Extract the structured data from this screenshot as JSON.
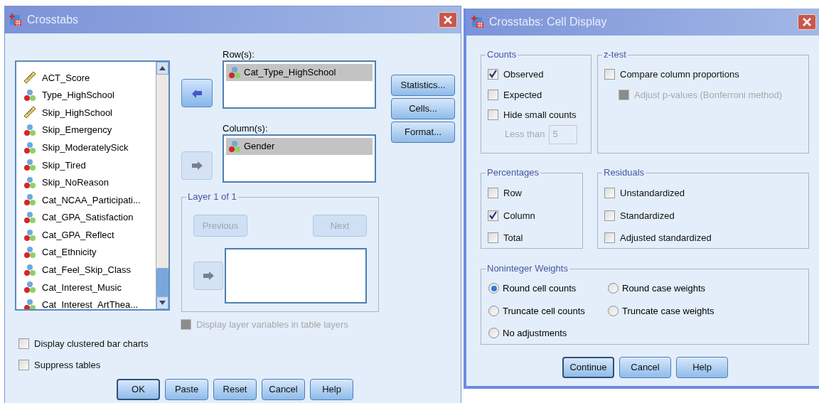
{
  "main_dialog": {
    "title": "Crosstabs",
    "variables": [
      {
        "name": "ACT_Score",
        "kind": "scale"
      },
      {
        "name": "Type_HighSchool",
        "kind": "nominal"
      },
      {
        "name": "Skip_HighSchool",
        "kind": "scale"
      },
      {
        "name": "Skip_Emergency",
        "kind": "nominal"
      },
      {
        "name": "Skip_ModeratelySick",
        "kind": "nominal"
      },
      {
        "name": "Skip_Tired",
        "kind": "nominal"
      },
      {
        "name": "Skip_NoReason",
        "kind": "nominal"
      },
      {
        "name": "Cat_NCAA_Participati...",
        "kind": "nominal"
      },
      {
        "name": "Cat_GPA_Satisfaction",
        "kind": "nominal"
      },
      {
        "name": "Cat_GPA_Reflect",
        "kind": "nominal"
      },
      {
        "name": "Cat_Ethnicity",
        "kind": "nominal"
      },
      {
        "name": "Cat_Feel_Skip_Class",
        "kind": "nominal"
      },
      {
        "name": "Cat_Interest_Music",
        "kind": "nominal"
      },
      {
        "name": "Cat_Interest_ArtThea...",
        "kind": "nominal"
      }
    ],
    "row_label": "Row(s):",
    "row_variables": [
      {
        "name": "Cat_Type_HighSchool",
        "kind": "nominal",
        "selected": true
      }
    ],
    "column_label": "Column(s):",
    "column_variables": [
      {
        "name": "Gender",
        "kind": "nominal",
        "selected": true
      }
    ],
    "arrow_buttons": [
      {
        "kind": "remove",
        "disabled": false
      },
      {
        "kind": "add",
        "disabled": true
      },
      {
        "kind": "add",
        "disabled": true
      }
    ],
    "layer": {
      "title": "Layer 1 of 1",
      "previous": {
        "label": "Previous",
        "disabled": true
      },
      "next": {
        "label": "Next",
        "disabled": true
      }
    },
    "display_layer": {
      "label": "Display layer variables in table layers",
      "checked": false,
      "disabled": true
    },
    "side_buttons": [
      "Statistics...",
      "Cells...",
      "Format..."
    ],
    "options": [
      {
        "label": "Display clustered bar charts",
        "checked": false
      },
      {
        "label": "Suppress tables",
        "checked": false
      }
    ],
    "buttons": [
      {
        "label": "OK",
        "default": true
      },
      {
        "label": "Paste",
        "default": false
      },
      {
        "label": "Reset",
        "default": false
      },
      {
        "label": "Cancel",
        "default": false
      },
      {
        "label": "Help",
        "default": false
      }
    ]
  },
  "cell_display": {
    "title": "Crosstabs: Cell Display",
    "counts": {
      "title": "Counts",
      "items": [
        {
          "label": "Observed",
          "checked": true
        },
        {
          "label": "Expected",
          "checked": false
        },
        {
          "label": "Hide small counts",
          "checked": false
        }
      ],
      "less_than": {
        "label": "Less than",
        "value": "5",
        "disabled": true
      }
    },
    "z_test": {
      "title": "z-test",
      "items": [
        {
          "label": "Compare column proportions",
          "checked": false,
          "disabled": false
        },
        {
          "label": "Adjust p-values (Bonferroni method)",
          "checked": false,
          "disabled": true
        }
      ]
    },
    "percentages": {
      "title": "Percentages",
      "items": [
        {
          "label": "Row",
          "checked": false
        },
        {
          "label": "Column",
          "checked": true
        },
        {
          "label": "Total",
          "checked": false
        }
      ]
    },
    "residuals": {
      "title": "Residuals",
      "items": [
        {
          "label": "Unstandardized",
          "checked": false
        },
        {
          "label": "Standardized",
          "checked": false
        },
        {
          "label": "Adjusted standardized",
          "checked": false
        }
      ]
    },
    "weights": {
      "title": "Noninteger Weights",
      "options": [
        {
          "label": "Round cell counts",
          "selected": true
        },
        {
          "label": "Round case weights",
          "selected": false
        },
        {
          "label": "Truncate cell counts",
          "selected": false
        },
        {
          "label": "Truncate case weights",
          "selected": false
        },
        {
          "label": "No adjustments",
          "selected": false
        }
      ]
    },
    "buttons": [
      {
        "label": "Continue",
        "default": true
      },
      {
        "label": "Cancel",
        "default": false
      },
      {
        "label": "Help",
        "default": false
      }
    ]
  }
}
